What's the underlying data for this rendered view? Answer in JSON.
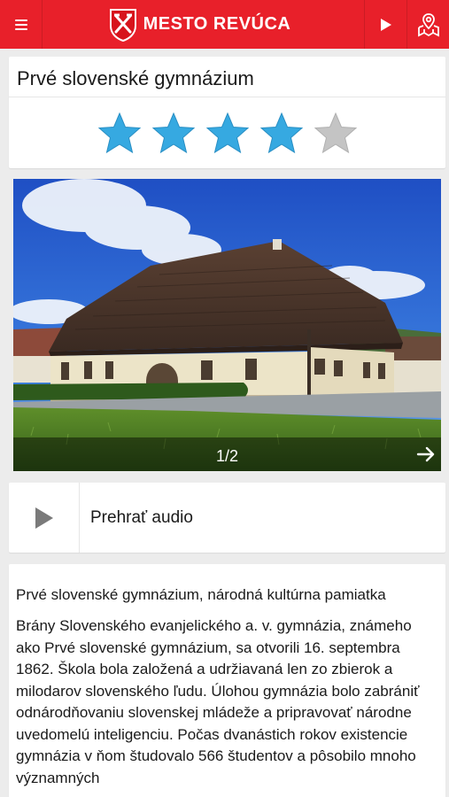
{
  "header": {
    "title": "MESTO REVÚCA",
    "menu_icon": "hamburger-menu-icon",
    "play_icon": "play-icon",
    "map_icon": "map-pin-icon",
    "color": "#e8202a"
  },
  "place": {
    "title": "Prvé slovenské gymnázium",
    "rating": 4,
    "rating_max": 5,
    "star_color_active": "#36a9e1",
    "star_color_inactive": "#c4c4c4"
  },
  "gallery": {
    "counter": "1/2",
    "current": 1,
    "total": 2
  },
  "audio": {
    "label": "Prehrať audio"
  },
  "description": {
    "lead": "Prvé slovenské gymnázium, národná kultúrna pamiatka",
    "body": "Brány Slovenského evanjelického a. v.  gymnázia, známeho ako Prvé slovenské gymnázium, sa otvorili 16. septembra 1862. Škola bola založená a udržiavaná len zo zbierok a milodarov slovenského ľudu. Úlohou gymnázia bolo zabrániť odnárodňovaniu slovenskej mládeže a pripravovať národne uvedomelú inteligenciu. Počas dvanástich rokov existencie gymnázia v ňom študovalo 566 študentov a pôsobilo mnoho významných"
  }
}
